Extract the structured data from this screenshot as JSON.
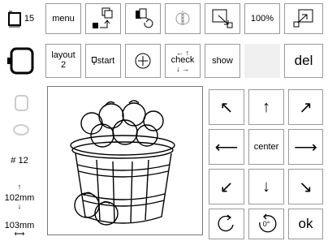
{
  "hoop_number": "15",
  "toolbar": {
    "menu_label": "menu",
    "zoom_label": "100%"
  },
  "row2": {
    "layout_label": "layout",
    "layout_value": "2",
    "start_label": "start",
    "check_label": "check",
    "show_label": "show",
    "del_label": "del"
  },
  "left_panel": {
    "design_number": "# 12",
    "height_value": "102mm",
    "width_value": "103mm"
  },
  "move_grid": {
    "center_label": "center",
    "rotate_label": "0°",
    "ok_label": "ok"
  }
}
